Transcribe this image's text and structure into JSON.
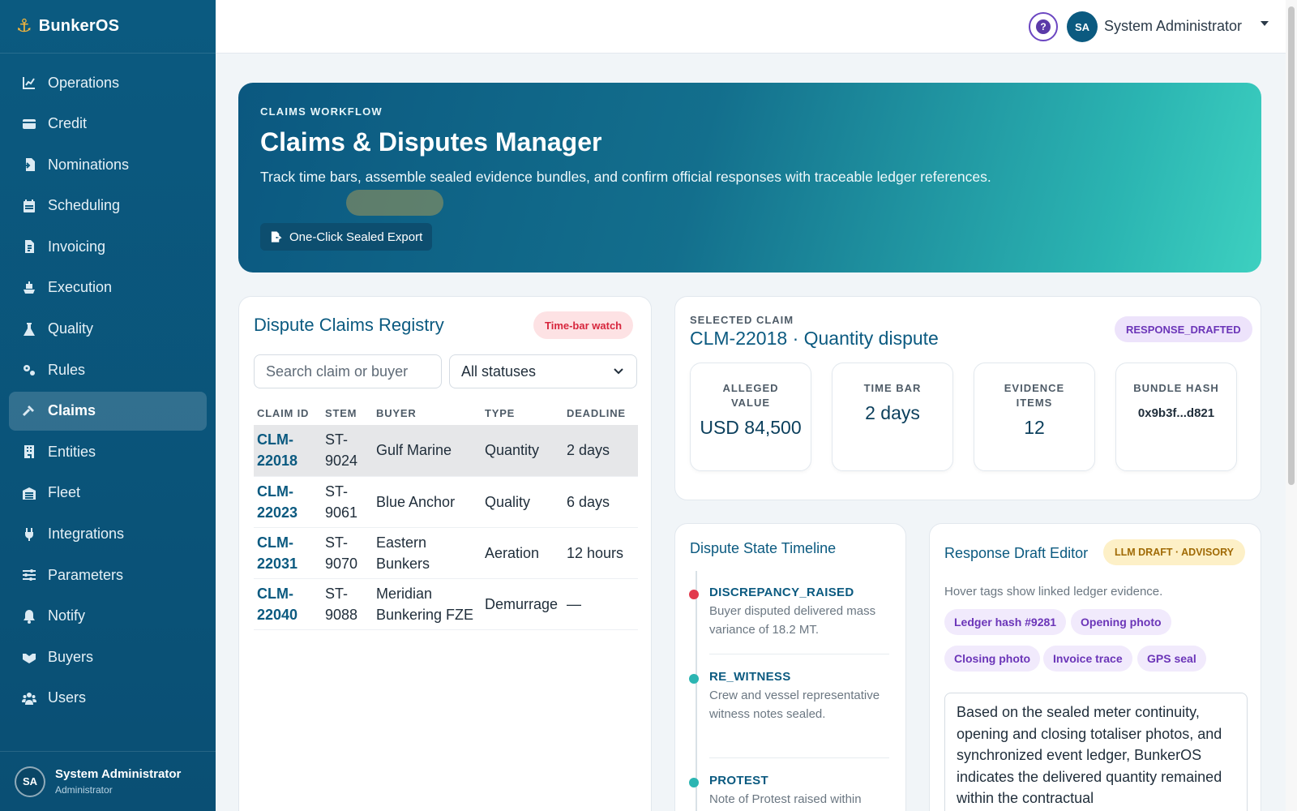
{
  "brand": {
    "name": "BunkerOS"
  },
  "nav": [
    {
      "label": "Operations",
      "icon": "chart-line-icon"
    },
    {
      "label": "Credit",
      "icon": "credit-card-icon"
    },
    {
      "label": "Nominations",
      "icon": "file-import-icon"
    },
    {
      "label": "Scheduling",
      "icon": "calendar-icon"
    },
    {
      "label": "Invoicing",
      "icon": "file-invoice-icon"
    },
    {
      "label": "Execution",
      "icon": "ship-icon"
    },
    {
      "label": "Quality",
      "icon": "flask-icon"
    },
    {
      "label": "Rules",
      "icon": "cogs-icon"
    },
    {
      "label": "Claims",
      "icon": "gavel-icon",
      "active": true
    },
    {
      "label": "Entities",
      "icon": "building-icon"
    },
    {
      "label": "Fleet",
      "icon": "warehouse-icon"
    },
    {
      "label": "Integrations",
      "icon": "plug-icon"
    },
    {
      "label": "Parameters",
      "icon": "sliders-icon"
    },
    {
      "label": "Notify",
      "icon": "bell-icon"
    },
    {
      "label": "Buyers",
      "icon": "handshake-icon"
    },
    {
      "label": "Users",
      "icon": "users-icon"
    }
  ],
  "sidebar_user": {
    "initials": "SA",
    "name": "System Administrator",
    "role": "Administrator"
  },
  "topbar": {
    "help": "?",
    "initials": "SA",
    "user": "System Administrator"
  },
  "hero": {
    "eyebrow": "CLAIMS WORKFLOW",
    "title": "Claims & Disputes Manager",
    "subtitle": "Track time bars, assemble sealed evidence bundles, and confirm official responses with traceable ledger references.",
    "export_label": "One-Click Sealed Export"
  },
  "registry": {
    "title": "Dispute Claims Registry",
    "badge": "Time-bar watch",
    "search_placeholder": "Search claim or buyer",
    "status_filter": "All statuses",
    "columns": [
      "CLAIM ID",
      "STEM",
      "BUYER",
      "TYPE",
      "DEADLINE"
    ],
    "rows": [
      {
        "id": "CLM-22018",
        "stem": "ST-9024",
        "buyer": "Gulf Marine",
        "type": "Quantity",
        "deadline": "2 days",
        "selected": true
      },
      {
        "id": "CLM-22023",
        "stem": "ST-9061",
        "buyer": "Blue Anchor",
        "type": "Quality",
        "deadline": "6 days"
      },
      {
        "id": "CLM-22031",
        "stem": "ST-9070",
        "buyer": "Eastern Bunkers",
        "type": "Aeration",
        "deadline": "12 hours"
      },
      {
        "id": "CLM-22040",
        "stem": "ST-9088",
        "buyer": "Meridian Bunkering FZE",
        "type": "Demurrage",
        "deadline": "—"
      }
    ]
  },
  "selected_claim": {
    "eyebrow": "SELECTED CLAIM",
    "title": "CLM-22018 · Quantity dispute",
    "status": "RESPONSE_DRAFTED",
    "metrics": [
      {
        "label": "ALLEGED VALUE",
        "value": "USD 84,500"
      },
      {
        "label": "TIME BAR",
        "value": "2 days"
      },
      {
        "label": "EVIDENCE ITEMS",
        "value": "12"
      },
      {
        "label": "BUNDLE HASH",
        "value": "0x9b3f...d821"
      }
    ]
  },
  "timeline": {
    "title": "Dispute State Timeline",
    "items": [
      {
        "state": "DISCREPANCY_RAISED",
        "desc": "Buyer disputed delivered mass variance of 18.2 MT.",
        "color": "#e23a4d"
      },
      {
        "state": "RE_WITNESS",
        "desc": "Crew and vessel representative witness notes sealed.",
        "color": "#2bb5b2"
      },
      {
        "state": "PROTEST",
        "desc": "Note of Protest raised within",
        "color": "#2bb5b2"
      }
    ]
  },
  "editor": {
    "title": "Response Draft Editor",
    "badge": "LLM DRAFT · ADVISORY",
    "hint": "Hover tags show linked ledger evidence.",
    "tags": [
      "Ledger hash #9281",
      "Opening photo",
      "Closing photo",
      "Invoice trace",
      "GPS seal"
    ],
    "draft": "Based on the sealed meter continuity, opening and closing totaliser photos, and synchronized event ledger, BunkerOS indicates the delivered quantity remained within the contractual"
  },
  "colors": {
    "sidebar": "#0b5a80",
    "accent_teal": "#2bb5b2",
    "danger": "#e23a4d",
    "purple": "#6b35b8"
  }
}
